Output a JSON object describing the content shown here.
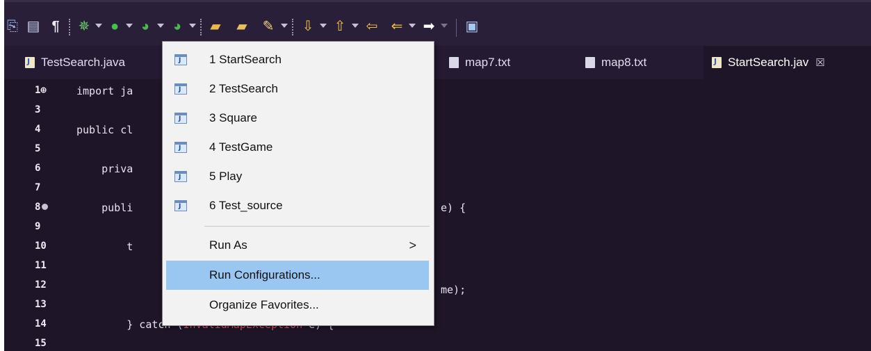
{
  "toolbar": {
    "icons": [
      "save-all-icon",
      "outline-icon",
      "show-whitespace-icon",
      "debug-icon",
      "run-icon",
      "coverage-icon",
      "external-tools-icon",
      "new-java-project-icon",
      "open-folder-icon",
      "highlighter-icon",
      "next-annotation-icon",
      "previous-annotation-icon",
      "last-edit-icon",
      "back-icon",
      "forward-icon",
      "perspective-icon"
    ],
    "pilcrow": "¶"
  },
  "tabs": [
    {
      "label": "TestSearch.java",
      "kind": "java"
    },
    {
      "label": "map7.txt",
      "kind": "txt"
    },
    {
      "label": "map8.txt",
      "kind": "txt"
    },
    {
      "label": "StartSearch.jav",
      "kind": "java",
      "active": true,
      "close": "☒"
    }
  ],
  "editor": {
    "lines": [
      {
        "num": "1⊕",
        "text": "import ja"
      },
      {
        "num": "3",
        "text": ""
      },
      {
        "num": "4",
        "text": "public cl"
      },
      {
        "num": "5",
        "text": ""
      },
      {
        "num": "6",
        "text": "    priva"
      },
      {
        "num": "7",
        "text": ""
      },
      {
        "num": "8",
        "text": "    publi"
      },
      {
        "num": "9",
        "text": ""
      },
      {
        "num": "10",
        "text": "        t"
      },
      {
        "num": "11",
        "text": ""
      },
      {
        "num": "12",
        "text": ""
      },
      {
        "num": "13",
        "text": ""
      },
      {
        "num": "14",
        "text": "        } catch ("
      },
      {
        "num": "15",
        "text": ""
      }
    ],
    "fragments": {
      "line8_tail": "e) {",
      "line12_tail": "me);",
      "line14_class": "InvalidMapException",
      "line14_tail": " e) {"
    }
  },
  "run_menu": {
    "history": [
      {
        "label": "1 StartSearch"
      },
      {
        "label": "2 TestSearch"
      },
      {
        "label": "3 Square"
      },
      {
        "label": "4 TestGame"
      },
      {
        "label": "5 Play"
      },
      {
        "label": "6 Test_source"
      }
    ],
    "run_as": "Run As",
    "run_as_arrow": ">",
    "run_configurations": "Run Configurations...",
    "organize_favorites": "Organize Favorites...",
    "highlighted": "Run Configurations..."
  },
  "colors": {
    "background": "#1e1628",
    "toolbar": "#2a1f38",
    "menu_bg": "#f2f2f2",
    "menu_highlight": "#99c7f2",
    "class_name": "#ff5c6b"
  }
}
